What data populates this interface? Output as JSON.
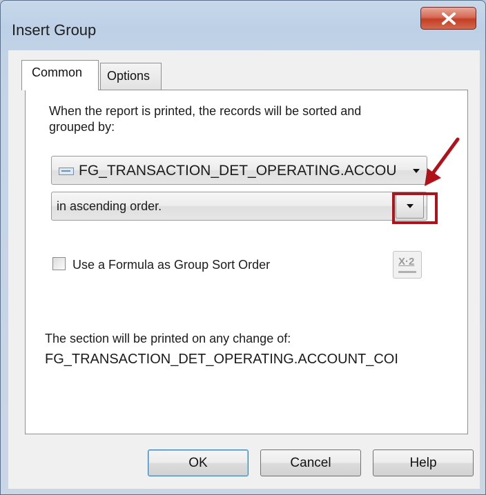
{
  "window": {
    "title": "Insert Group",
    "close_label": "x"
  },
  "tabs": [
    {
      "label": "Common",
      "active": true
    },
    {
      "label": "Options",
      "active": false
    }
  ],
  "common": {
    "sort_prompt_line1": "When the report is printed, the records will be sorted and",
    "sort_prompt_line2": "grouped by:",
    "group_field": {
      "value": "FG_TRANSACTION_DET_OPERATING.ACCOU",
      "icon": "field-icon"
    },
    "sort_order": {
      "value": "in ascending order."
    },
    "formula_checkbox": {
      "label": "Use a Formula as Group Sort Order",
      "checked": false
    },
    "formula_button_label": "X·2",
    "section_note": "The section will be printed on any change of:",
    "section_field": "FG_TRANSACTION_DET_OPERATING.ACCOUNT_COI"
  },
  "buttons": {
    "ok": "OK",
    "cancel": "Cancel",
    "help": "Help"
  },
  "annotation_color": "#b0121b"
}
